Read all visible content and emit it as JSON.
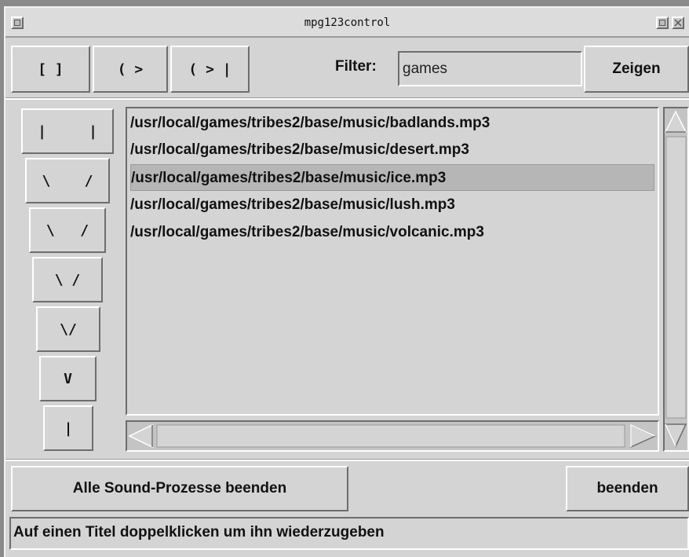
{
  "window": {
    "title": "mpg123control"
  },
  "toolbar": {
    "stop_label": "[ ]",
    "play_label": "( >",
    "play_end_label": "( > |",
    "filter_label": "Filter:",
    "filter_value": "games",
    "show_label": "Zeigen"
  },
  "volume": {
    "levels": [
      "|     |",
      "\\    /",
      "\\   /",
      "\\ /",
      "\\/",
      "V",
      "|"
    ]
  },
  "playlist": {
    "items": [
      "/usr/local/games/tribes2/base/music/badlands.mp3",
      "/usr/local/games/tribes2/base/music/desert.mp3",
      "/usr/local/games/tribes2/base/music/ice.mp3",
      "/usr/local/games/tribes2/base/music/lush.mp3",
      "/usr/local/games/tribes2/base/music/volcanic.mp3"
    ],
    "selected_index": 2
  },
  "footer": {
    "kill_all_label": "Alle Sound-Prozesse beenden",
    "quit_label": "beenden"
  },
  "status": {
    "text": "Auf einen Titel doppelklicken um ihn wiederzugeben"
  }
}
